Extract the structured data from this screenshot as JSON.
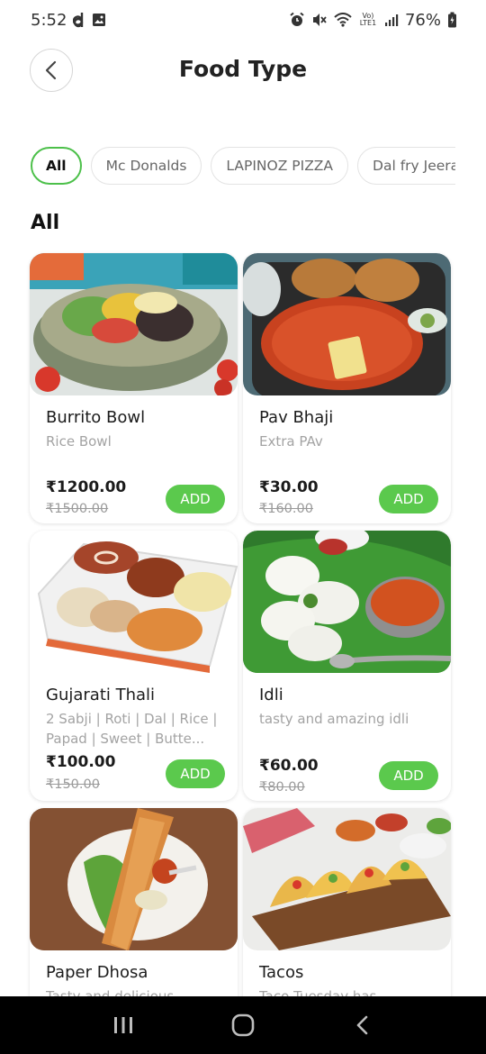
{
  "status_bar": {
    "time": "5:52",
    "battery": "76%",
    "network": "Vo) LTE1"
  },
  "header": {
    "title": "Food Type",
    "back_icon": "chevron-left-icon"
  },
  "chips": [
    {
      "label": "All",
      "active": true
    },
    {
      "label": "Mc Donalds",
      "active": false
    },
    {
      "label": "LAPINOZ PIZZA",
      "active": false
    },
    {
      "label": "Dal fry Jeera",
      "active": false
    }
  ],
  "section_title": "All",
  "products": [
    {
      "name": "Burrito Bowl",
      "description": "Rice Bowl",
      "price": "₹1200.00",
      "mrp": "₹1500.00",
      "add_label": "ADD"
    },
    {
      "name": "Pav Bhaji",
      "description": "Extra PAv",
      "price": "₹30.00",
      "mrp": "₹160.00",
      "add_label": "ADD"
    },
    {
      "name": "Gujarati Thali",
      "description": "2 Sabji | Roti | Dal | Rice | Papad | Sweet | Butte...",
      "price": "₹100.00",
      "mrp": "₹150.00",
      "add_label": "ADD"
    },
    {
      "name": "Idli",
      "description": "tasty and amazing idli",
      "price": "₹60.00",
      "mrp": "₹80.00",
      "add_label": "ADD"
    },
    {
      "name": "Paper Dhosa",
      "description": "Tasty and delicious",
      "price": "",
      "mrp": "",
      "add_label": ""
    },
    {
      "name": "Tacos",
      "description": "Taco Tuesday has",
      "price": "",
      "mrp": "",
      "add_label": ""
    }
  ],
  "nav_bar": {
    "recents_icon": "recents-icon",
    "home_icon": "home-icon",
    "back_icon": "back-icon"
  },
  "colors": {
    "accent_green": "#5bc94d",
    "chip_active_border": "#4cc04a"
  }
}
